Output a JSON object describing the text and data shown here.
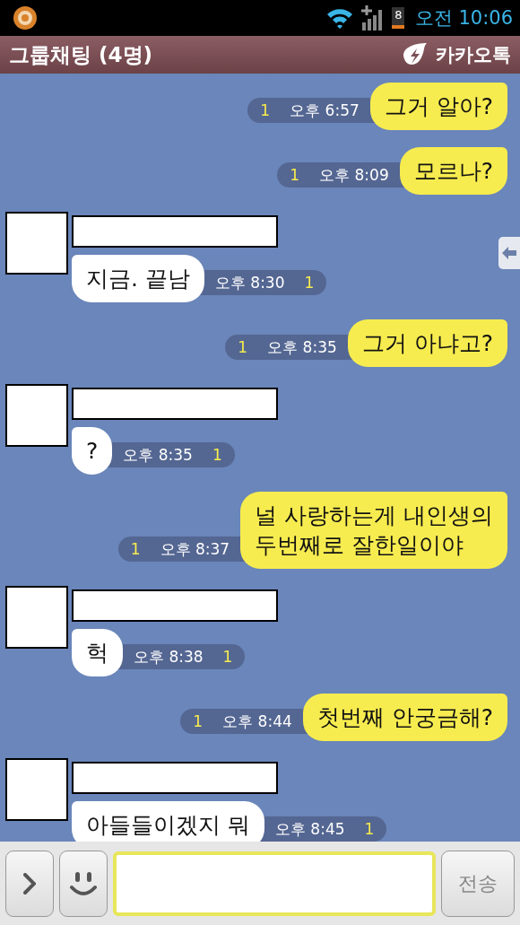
{
  "status_bar": {
    "battery": "8",
    "period": "오전",
    "time": "10:06"
  },
  "header": {
    "title": "그룹채팅 (4명)",
    "app_name": "카카오톡"
  },
  "messages": [
    {
      "kind": "sent",
      "text": "그거 알아?",
      "unread": "1",
      "time": "오후 6:57"
    },
    {
      "kind": "sent",
      "text": "모르나?",
      "unread": "1",
      "time": "오후 8:09"
    },
    {
      "kind": "received",
      "text": "지금. 끝남",
      "unread": "1",
      "time": "오후 8:30"
    },
    {
      "kind": "sent",
      "text": "그거 아냐고?",
      "unread": "1",
      "time": "오후 8:35"
    },
    {
      "kind": "received",
      "text": "?",
      "unread": "1",
      "time": "오후 8:35"
    },
    {
      "kind": "sent",
      "text": "널 사랑하는게 내인생의\n두번째로 잘한일이야",
      "unread": "1",
      "time": "오후 8:37"
    },
    {
      "kind": "received",
      "text": "헉",
      "unread": "1",
      "time": "오후 8:38"
    },
    {
      "kind": "sent",
      "text": "첫번째 안궁금해?",
      "unread": "1",
      "time": "오후 8:44"
    },
    {
      "kind": "received",
      "text": "아들들이겠지 뭐",
      "unread": "1",
      "time": "오후 8:45"
    }
  ],
  "input_bar": {
    "send_label": "전송"
  }
}
